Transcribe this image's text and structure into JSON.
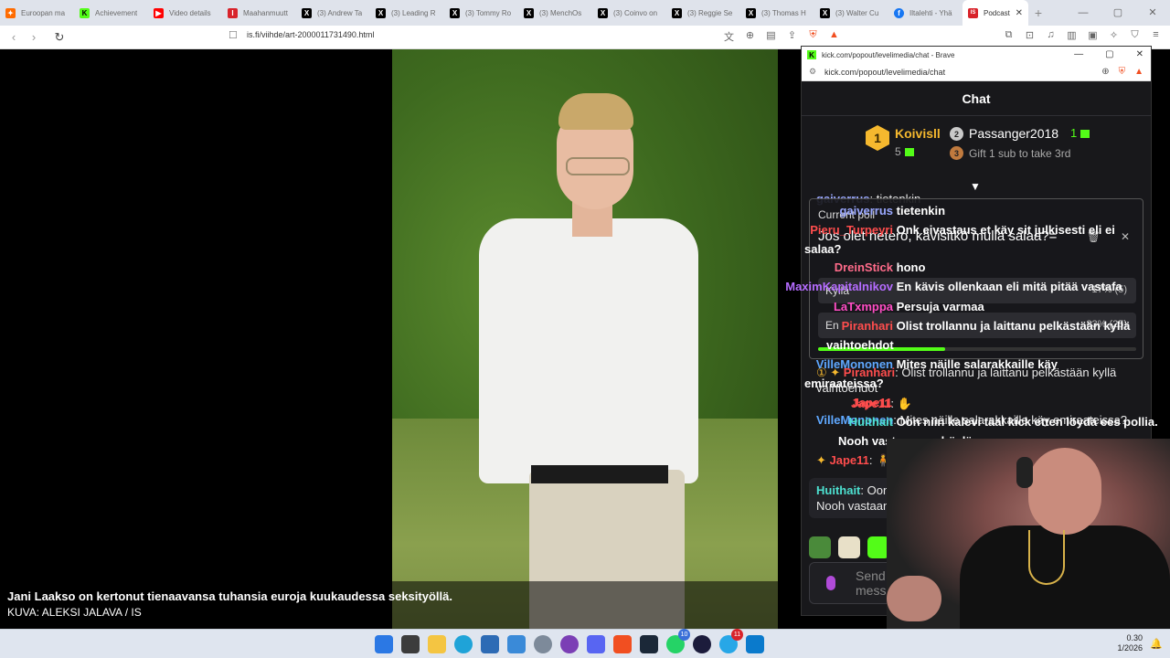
{
  "browser": {
    "tabs": [
      {
        "label": "Euroopan ma",
        "fav_color": "#ff6b00",
        "fav_glyph": "✦"
      },
      {
        "label": "Achievement",
        "fav_color": "#53fc18",
        "fav_glyph": "K"
      },
      {
        "label": "Video details",
        "fav_color": "#ff0000",
        "fav_glyph": "▶"
      },
      {
        "label": "Maahanmuutt",
        "fav_color": "#d8232a",
        "fav_glyph": "I"
      },
      {
        "label": "(3) Andrew Ta",
        "fav_color": "#000000",
        "fav_glyph": "X"
      },
      {
        "label": "(3) Leading R",
        "fav_color": "#000000",
        "fav_glyph": "X"
      },
      {
        "label": "(3) Tommy Ro",
        "fav_color": "#000000",
        "fav_glyph": "X"
      },
      {
        "label": "(3) MenchOs",
        "fav_color": "#000000",
        "fav_glyph": "X"
      },
      {
        "label": "(3) Coinvo on",
        "fav_color": "#000000",
        "fav_glyph": "X"
      },
      {
        "label": "(3) Reggie Se",
        "fav_color": "#000000",
        "fav_glyph": "X"
      },
      {
        "label": "(3) Thomas H",
        "fav_color": "#000000",
        "fav_glyph": "X"
      },
      {
        "label": "(3) Walter Cu",
        "fav_color": "#000000",
        "fav_glyph": "X"
      },
      {
        "label": "Iltalehti - Yhä",
        "fav_color": "#1877f2",
        "fav_glyph": "f"
      },
      {
        "label": "Podcast",
        "fav_color": "#d8232a",
        "fav_glyph": "IS"
      }
    ],
    "new_tab": "+",
    "url": "is.fi/viihde/art-2000011731490.html"
  },
  "article": {
    "caption_line1": "Jani Laakso on kertonut tienaavansa tuhansia euroja kuukaudessa seksityöllä.",
    "caption_line2": "KUVA: ALEKSI JALAVA / IS"
  },
  "popout": {
    "window_title": "kick.com/popout/levelimedia/chat - Brave",
    "url": "kick.com/popout/levelimedia/chat",
    "chat_title": "Chat",
    "gifters": {
      "first": {
        "rank": "1",
        "name": "Koivisll",
        "count": "5"
      },
      "second": {
        "rank": "2",
        "name": "Passanger2018",
        "count": "1"
      },
      "third": {
        "rank": "3",
        "text": "Gift 1 sub to take 3rd"
      }
    },
    "poll": {
      "label": "Current poll",
      "question": "Jos olet hetero, kävisitkö mulla salaa?=",
      "options": [
        {
          "label": "Kyllä",
          "percent": "17% (5)"
        },
        {
          "label": "En",
          "percent": "83% (25)"
        }
      ],
      "progress": 0.4
    },
    "messages": {
      "m1": {
        "user": "gaiverrus",
        "text": ": tietenkin"
      },
      "m2": {
        "user": "Piranhari",
        "text": ": Olist trollannu ja laittanu pelkästään kyllä vaihtoehdot"
      },
      "m3": {
        "user": "Jape11",
        "text": ":"
      },
      "m4": {
        "user": "VilleMononen",
        "text": ": Mites näille salarakkaille käy emiraateissa?"
      },
      "m5": {
        "user": "Jape11",
        "text": ":"
      },
      "m6": {
        "user": "Huithait",
        "text": ": Oon niin kalevi tääl kick etten löydä ees pollia. Nooh vastaan puuhöylä"
      }
    },
    "overlay": [
      {
        "user": "gaiverrus",
        "text": "tietenkin",
        "color": "#9aa8ff"
      },
      {
        "user": "Pieru_Turpeyri",
        "text": "Onk eivastaus et käy sit julkisesti eli ei salaa?",
        "color": "#ff4d4d"
      },
      {
        "user": "DreinStick",
        "text": "hono",
        "color": "#ff6b8a"
      },
      {
        "user": "MaximKapitalnikov",
        "text": "En kävis ollenkaan eli mitä pitää vastafa",
        "color": "#b56cff"
      },
      {
        "user": "LaTxmppa",
        "text": "Persuja varmaa",
        "color": "#ff4dc4"
      },
      {
        "user": "Piranhari",
        "text": "Olist trollannu ja laittanu pelkästään kyllä vaihtoehdot",
        "color": "#ff4d4d"
      },
      {
        "user": "VilleMononen",
        "text": "Mites näille salarakkaille käy emiraateissa?",
        "color": "#5fa8ff"
      },
      {
        "user": "Jape11",
        "text": "",
        "color": "#ff4d4d"
      },
      {
        "user": "Huithait",
        "text": "Oon niin kalevi tääl kick etten löydä ees pollia. Nooh vastaan puuhöylä",
        "color": "#4de0d0"
      }
    ],
    "send_placeholder": "Send a message"
  },
  "taskbar": {
    "time": "0.30",
    "date": "1/2026",
    "badges": {
      "whatsapp": "10",
      "telegram": "11"
    }
  }
}
